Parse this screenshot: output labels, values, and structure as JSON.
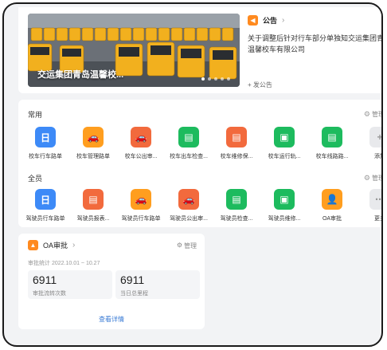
{
  "banner": {
    "caption": "交运集团青岛温馨校...",
    "slides": 5,
    "active_slide": 0
  },
  "notice": {
    "title": "公告",
    "text": "关于调整后针对行车部分单独知交运集团青岛温馨校车有限公司",
    "new_label": "+ 发公告"
  },
  "section1": {
    "title": "常用",
    "manage_label": "管理",
    "apps": [
      {
        "label": "校车行车路单",
        "icon": "calendar-icon",
        "color": "#3d8af7",
        "glyph": "日"
      },
      {
        "label": "校车管理路单",
        "icon": "car-icon",
        "color": "#ff9e1f",
        "glyph": "🚗"
      },
      {
        "label": "校车公出审...",
        "icon": "car-icon",
        "color": "#f26a3d",
        "glyph": "🚗"
      },
      {
        "label": "校车出车检查...",
        "icon": "document-icon",
        "color": "#1dbb5e",
        "glyph": "▤"
      },
      {
        "label": "校车维修保...",
        "icon": "document-icon",
        "color": "#f26a3d",
        "glyph": "▤"
      },
      {
        "label": "校车运行轨...",
        "icon": "archive-icon",
        "color": "#1dbb5e",
        "glyph": "▣"
      },
      {
        "label": "校车线路路...",
        "icon": "document-icon",
        "color": "#1dbb5e",
        "glyph": "▤"
      },
      {
        "label": "添加",
        "icon": "plus-icon",
        "color": "#e8e9ec",
        "glyph": "+"
      }
    ]
  },
  "section2": {
    "title": "全员",
    "manage_label": "管理",
    "apps": [
      {
        "label": "驾驶员行车路单",
        "icon": "calendar-icon",
        "color": "#3d8af7",
        "glyph": "日"
      },
      {
        "label": "驾驶员报表...",
        "icon": "document-icon",
        "color": "#f26a3d",
        "glyph": "▤"
      },
      {
        "label": "驾驶员行车路单",
        "icon": "car-icon",
        "color": "#ff9e1f",
        "glyph": "🚗"
      },
      {
        "label": "驾驶员公出审...",
        "icon": "car-icon",
        "color": "#f26a3d",
        "glyph": "🚗"
      },
      {
        "label": "驾驶员检查...",
        "icon": "document-icon",
        "color": "#1dbb5e",
        "glyph": "▤"
      },
      {
        "label": "驾驶员维修...",
        "icon": "archive-icon",
        "color": "#1dbb5e",
        "glyph": "▣"
      },
      {
        "label": "OA审批",
        "icon": "person-icon",
        "color": "#ff9e1f",
        "glyph": "👤"
      },
      {
        "label": "更多",
        "icon": "more-icon",
        "color": "#e8e9ec",
        "glyph": "⋯"
      }
    ]
  },
  "oa": {
    "title": "OA审批",
    "manage_label": "管理",
    "stat_label": "审批统计 2022.10.01 ~ 10.27",
    "stats": [
      {
        "value": "6911",
        "label": "审批流转次数"
      },
      {
        "value": "6911",
        "label": "当日总里程"
      }
    ],
    "detail_label": "查看详情"
  }
}
